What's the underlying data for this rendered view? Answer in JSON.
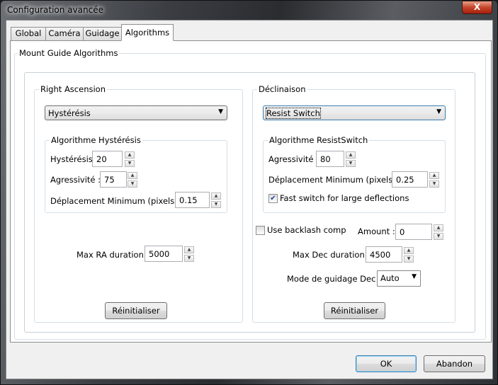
{
  "window": {
    "title": "Configuration avancée",
    "close": "X"
  },
  "tabs": [
    "Global",
    "Caméra",
    "Guidage",
    "Algorithms"
  ],
  "group_title": "Mount Guide Algorithms",
  "ra": {
    "title": "Right Ascension",
    "algorithm": "Hystérésis",
    "sub_title": "Algorithme Hystérésis",
    "hysteresis_label": "Hystérésis :",
    "hysteresis": "20",
    "aggr_label": "Agressivité :",
    "aggr": "75",
    "min_move_label": "Déplacement Minimum (pixels) :",
    "min_move": "0.15",
    "max_label": "Max RA duration :",
    "max": "5000",
    "reset": "Réinitialiser"
  },
  "dec": {
    "title": "Déclinaison",
    "algorithm": "Resist Switch",
    "sub_title": "Algorithme ResistSwitch",
    "aggr_label": "Agressivité :",
    "aggr": "80",
    "min_move_label": "Déplacement Minimum (pixels) :",
    "min_move": "0.25",
    "fast_switch_label": "Fast switch for large deflections",
    "fast_switch": true,
    "backlash_label": "Use backlash comp",
    "backlash": false,
    "amount_label": "Amount :",
    "amount": "0",
    "max_label": "Max Dec duration :",
    "max": "4500",
    "mode_label": "Mode de guidage Dec :",
    "mode": "Auto",
    "reset": "Réinitialiser"
  },
  "buttons": {
    "ok": "OK",
    "cancel": "Abandon"
  }
}
